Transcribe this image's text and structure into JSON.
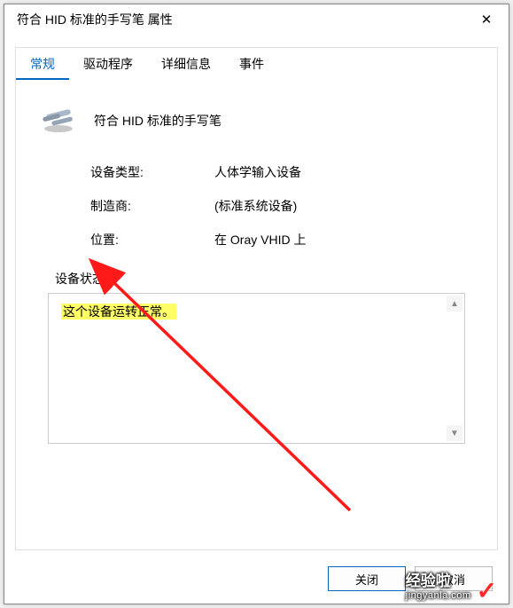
{
  "window": {
    "title": "符合 HID 标准的手写笔 属性",
    "close_glyph": "✕"
  },
  "tabs": {
    "general": "常规",
    "driver": "驱动程序",
    "details": "详细信息",
    "events": "事件"
  },
  "device": {
    "name": "符合 HID 标准的手写笔"
  },
  "info": {
    "type_label": "设备类型:",
    "type_value": "人体学输入设备",
    "mfg_label": "制造商:",
    "mfg_value": "(标准系统设备)",
    "loc_label": "位置:",
    "loc_value": "在 Oray VHID 上"
  },
  "status": {
    "label": "设备状态",
    "text": "这个设备运转正常。"
  },
  "buttons": {
    "close": "关闭",
    "cancel": "取消"
  },
  "watermark": {
    "brand": "经验啦",
    "site": "jingyanla.com"
  }
}
